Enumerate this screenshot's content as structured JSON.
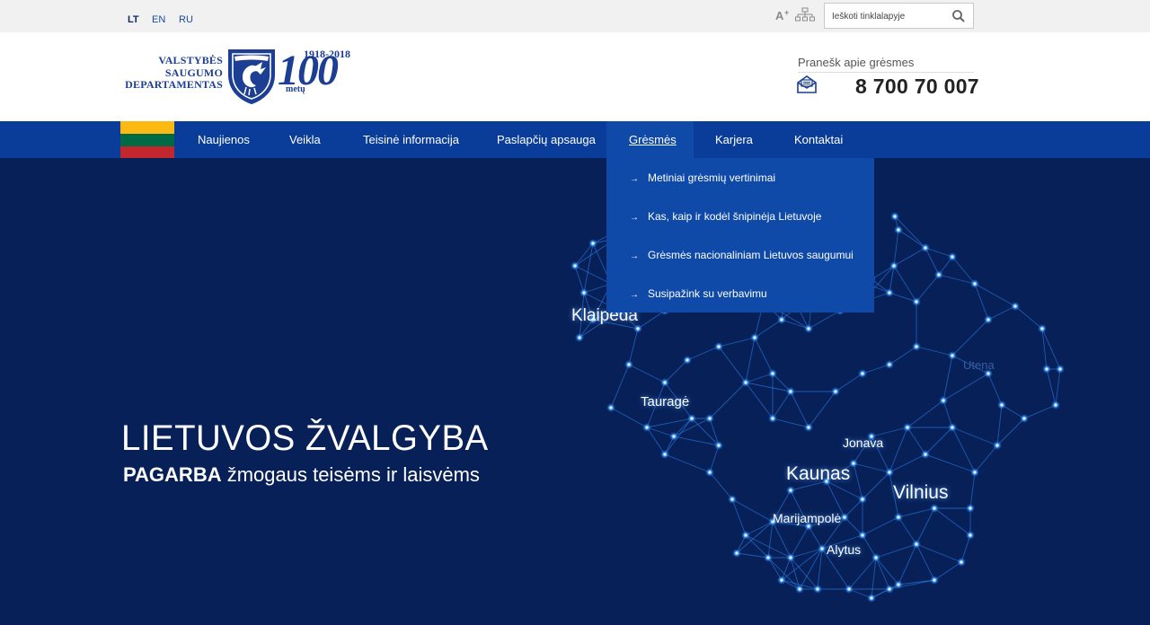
{
  "topbar": {
    "languages": [
      "LT",
      "EN",
      "RU"
    ],
    "search_placeholder": "Ieškoti tinklalapyje",
    "icons": [
      "text-size-icon",
      "sitemap-icon",
      "search-icon"
    ]
  },
  "logo": {
    "line1": "VALSTYBĖS",
    "line2": "SAUGUMO",
    "line3": "DEPARTAMENTAS",
    "years": "1918-2018",
    "number": "100",
    "suffix": "metų"
  },
  "report": {
    "label": "Pranešk apie grėsmes",
    "phone": "8 700 70 007"
  },
  "nav": {
    "items": [
      "Naujienos",
      "Veikla",
      "Teisinė informacija",
      "Paslapčių apsauga",
      "Grėsmės",
      "Karjera",
      "Kontaktai"
    ],
    "active": "Grėsmės"
  },
  "dropdown": {
    "items": [
      "Metiniai grėsmių vertinimai",
      "Kas, kaip ir kodėl šnipinėja Lietuvoje",
      "Grėsmės nacionaliniam Lietuvos saugumui",
      "Susipažink su verbavimu"
    ]
  },
  "hero": {
    "title": "LIETUVOS ŽVALGYBA",
    "subtitle_bold": "PAGARBA",
    "subtitle_rest": " žmogaus teisėms ir laisvėms",
    "cities": [
      "Klaipėda",
      "Tauragė",
      "Utena",
      "Jonava",
      "Kaunas",
      "Vilnius",
      "Marijampolė",
      "Alytus"
    ]
  },
  "colors": {
    "brand_blue": "#1c3f94",
    "nav_bg": "#0a3d99",
    "nav_active": "#0f4aa8",
    "hero_bg": "#072058",
    "flag": [
      "#fdb913",
      "#006a44",
      "#c1272d"
    ]
  }
}
